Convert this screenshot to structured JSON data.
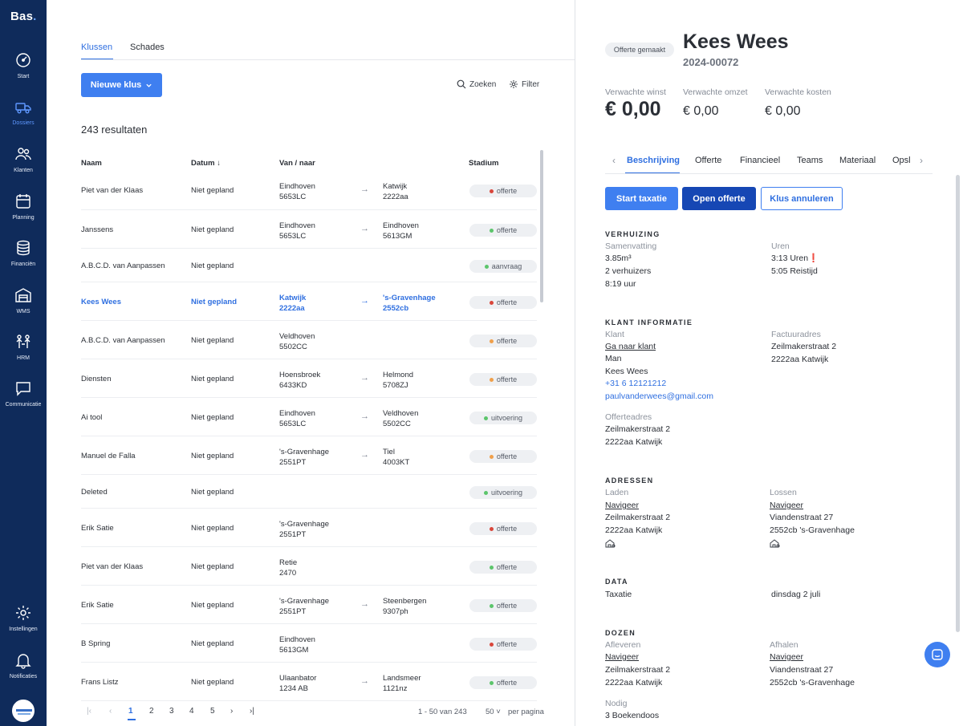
{
  "sidebar": {
    "logo": "Bas",
    "logo_dot": ".",
    "items": [
      {
        "label": "Start",
        "icon": "gauge-icon"
      },
      {
        "label": "Dossiers",
        "icon": "truck-icon"
      },
      {
        "label": "Klanten",
        "icon": "users-icon"
      },
      {
        "label": "Planning",
        "icon": "calendar-icon"
      },
      {
        "label": "Financiën",
        "icon": "coins-icon"
      },
      {
        "label": "WMS",
        "icon": "warehouse-icon"
      },
      {
        "label": "HRM",
        "icon": "team-icon"
      },
      {
        "label": "Communicatie",
        "icon": "chat-icon"
      },
      {
        "label": "Instellingen",
        "icon": "gear-icon"
      },
      {
        "label": "Notificaties",
        "icon": "bell-icon"
      }
    ],
    "active": "Dossiers"
  },
  "list": {
    "tabs": [
      "Klussen",
      "Schades"
    ],
    "new_button": "Nieuwe klus",
    "search": "Zoeken",
    "filter": "Filter",
    "results": "243 resultaten",
    "columns": [
      "Naam",
      "Datum",
      "Van / naar",
      "Stadium"
    ],
    "rows": [
      {
        "name": "Piet van der Klaas",
        "date": "Niet gepland",
        "from1": "Eindhoven",
        "from2": "5653LC",
        "to1": "Katwijk",
        "to2": "2222aa",
        "status": "offerte",
        "color": "#d9463b"
      },
      {
        "name": "Janssens",
        "date": "Niet gepland",
        "from1": "Eindhoven",
        "from2": "5653LC",
        "to1": "Eindhoven",
        "to2": "5613GM",
        "status": "offerte",
        "color": "#5cc56b"
      },
      {
        "name": "A.B.C.D. van Aanpassen",
        "date": "Niet gepland",
        "from1": "",
        "from2": "",
        "to1": "",
        "to2": "",
        "status": "aanvraag",
        "color": "#5cc56b"
      },
      {
        "name": "Kees Wees",
        "date": "Niet gepland",
        "from1": "Katwijk",
        "from2": "2222aa",
        "to1": "'s-Gravenhage",
        "to2": "2552cb",
        "status": "offerte",
        "color": "#d9463b"
      },
      {
        "name": "A.B.C.D. van Aanpassen",
        "date": "Niet gepland",
        "from1": "Veldhoven",
        "from2": "5502CC",
        "to1": "",
        "to2": "",
        "status": "offerte",
        "color": "#f0a04b"
      },
      {
        "name": "Diensten",
        "date": "Niet gepland",
        "from1": "Hoensbroek",
        "from2": "6433KD",
        "to1": "Helmond",
        "to2": "5708ZJ",
        "status": "offerte",
        "color": "#f0a04b"
      },
      {
        "name": "Ai tool",
        "date": "Niet gepland",
        "from1": "Eindhoven",
        "from2": "5653LC",
        "to1": "Veldhoven",
        "to2": "5502CC",
        "status": "uitvoering",
        "color": "#5cc56b"
      },
      {
        "name": "Manuel de Falla",
        "date": "Niet gepland",
        "from1": "'s-Gravenhage",
        "from2": "2551PT",
        "to1": "Tiel",
        "to2": "4003KT",
        "status": "offerte",
        "color": "#f0a04b"
      },
      {
        "name": "Deleted",
        "date": "Niet gepland",
        "from1": "",
        "from2": "",
        "to1": "",
        "to2": "",
        "status": "uitvoering",
        "color": "#5cc56b"
      },
      {
        "name": "Erik Satie",
        "date": "Niet gepland",
        "from1": "'s-Gravenhage",
        "from2": "2551PT",
        "to1": "",
        "to2": "",
        "status": "offerte",
        "color": "#d9463b"
      },
      {
        "name": "Piet van der Klaas",
        "date": "Niet gepland",
        "from1": "Retie",
        "from2": "2470",
        "to1": "",
        "to2": "",
        "status": "offerte",
        "color": "#5cc56b"
      },
      {
        "name": "Erik Satie",
        "date": "Niet gepland",
        "from1": "'s-Gravenhage",
        "from2": "2551PT",
        "to1": "Steenbergen",
        "to2": "9307ph",
        "status": "offerte",
        "color": "#5cc56b"
      },
      {
        "name": "B Spring",
        "date": "Niet gepland",
        "from1": "Eindhoven",
        "from2": "5613GM",
        "to1": "",
        "to2": "",
        "status": "offerte",
        "color": "#d9463b"
      },
      {
        "name": "Frans Listz",
        "date": "Niet gepland",
        "from1": "Ulaanbator",
        "from2": "1234 AB",
        "to1": "Landsmeer",
        "to2": "1121nz",
        "status": "offerte",
        "color": "#5cc56b"
      }
    ],
    "selected_index": 3,
    "pagination": {
      "first": "|‹",
      "prev": "‹",
      "pages": [
        "1",
        "2",
        "3",
        "4",
        "5"
      ],
      "current": "1",
      "next": "›",
      "last": "›|",
      "range": "1 - 50 van 243",
      "per_page": "50",
      "per_page_label": "per pagina"
    }
  },
  "detail": {
    "status": "Offerte gemaakt",
    "title": "Kees Wees",
    "number": "2024-00072",
    "kpis": [
      {
        "label": "Verwachte winst",
        "value": "€ 0,00"
      },
      {
        "label": "Verwachte omzet",
        "value": "€ 0,00"
      },
      {
        "label": "Verwachte kosten",
        "value": "€ 0,00"
      }
    ],
    "tabs": [
      "Beschrijving",
      "Offerte",
      "Financieel",
      "Teams",
      "Materiaal",
      "Opsl"
    ],
    "buttons": {
      "taxatie": "Start taxatie",
      "offerte": "Open offerte",
      "annuleren": "Klus annuleren"
    },
    "verhuizing": {
      "title": "VERHUIZING",
      "summary_label": "Samenvatting",
      "summary": [
        "3.85m³",
        "2 verhuizers",
        "8:19 uur"
      ],
      "hours_label": "Uren",
      "hours": [
        "3:13 Uren❗",
        "5:05 Reistijd"
      ]
    },
    "klant": {
      "title": "KLANT INFORMATIE",
      "klant_label": "Klant",
      "link": "Ga naar klant",
      "gender": "Man",
      "name": "Kees Wees",
      "phone": "+31 6 12121212",
      "email": "paulvanderwees@gmail.com",
      "factuur_label": "Factuuradres",
      "factuur": [
        "Zeilmakerstraat 2",
        "2222aa Katwijk"
      ],
      "offerte_label": "Offerteadres",
      "offerte": [
        "Zeilmakerstraat 2",
        "2222aa Katwijk"
      ]
    },
    "adressen": {
      "title": "ADRESSEN",
      "laden_label": "Laden",
      "laden": [
        "Navigeer",
        "Zeilmakerstraat 2",
        "2222aa Katwijk"
      ],
      "lossen_label": "Lossen",
      "lossen": [
        "Navigeer",
        "Viandenstraat 27",
        "2552cb 's-Gravenhage"
      ]
    },
    "data": {
      "title": "DATA",
      "label": "Taxatie",
      "value": "dinsdag 2 juli"
    },
    "dozen": {
      "title": "DOZEN",
      "afleveren_label": "Afleveren",
      "afleveren": [
        "Navigeer",
        "Zeilmakerstraat 2",
        "2222aa Katwijk"
      ],
      "afhalen_label": "Afhalen",
      "afhalen": [
        "Navigeer",
        "Viandenstraat 27",
        "2552cb 's-Gravenhage"
      ],
      "nodig_label": "Nodig",
      "nodig": "3 Boekendoos"
    }
  },
  "colors": {
    "sidebar": "#0f2b5b",
    "accent": "#3f7ff0",
    "dark_button": "#1647b4",
    "red": "#d9463b",
    "green": "#5cc56b",
    "orange": "#f0a04b"
  }
}
